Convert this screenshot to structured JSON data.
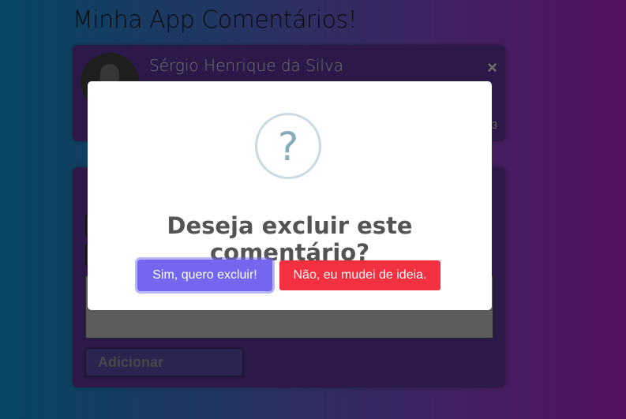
{
  "page": {
    "title": "Minha App Comentários!"
  },
  "comment": {
    "author": "Sérgio Henrique da Silva",
    "delete_symbol": "×",
    "date_fragment": "3"
  },
  "form": {
    "submit_label": "Adicionar"
  },
  "dialog": {
    "icon": "question-icon",
    "icon_glyph": "?",
    "title": "Deseja excluir este comentário?",
    "confirm_label": "Sim, quero excluir!",
    "cancel_label": "Não, eu mudei de ideia.",
    "confirm_color": "#7367f0",
    "cancel_color": "#f2303f"
  }
}
